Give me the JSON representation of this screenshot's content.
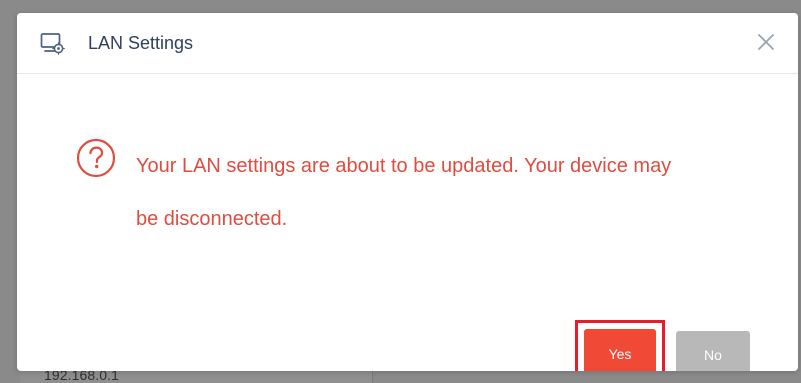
{
  "background": {
    "ip_text": "192.168.0.1"
  },
  "dialog": {
    "title": "LAN Settings",
    "message": "Your LAN settings are about to be updated. Your device may be disconnected.",
    "icons": {
      "header": "monitor-gear-icon",
      "close": "close-icon",
      "warning": "question-circle-icon"
    },
    "buttons": {
      "yes": "Yes",
      "no": "No"
    },
    "colors": {
      "title_text": "#2e3f5f",
      "message_text": "#e14c40",
      "yes_button": "#f04a37",
      "no_button": "#b8b8b8",
      "highlight_border": "#ec1b2a"
    }
  }
}
